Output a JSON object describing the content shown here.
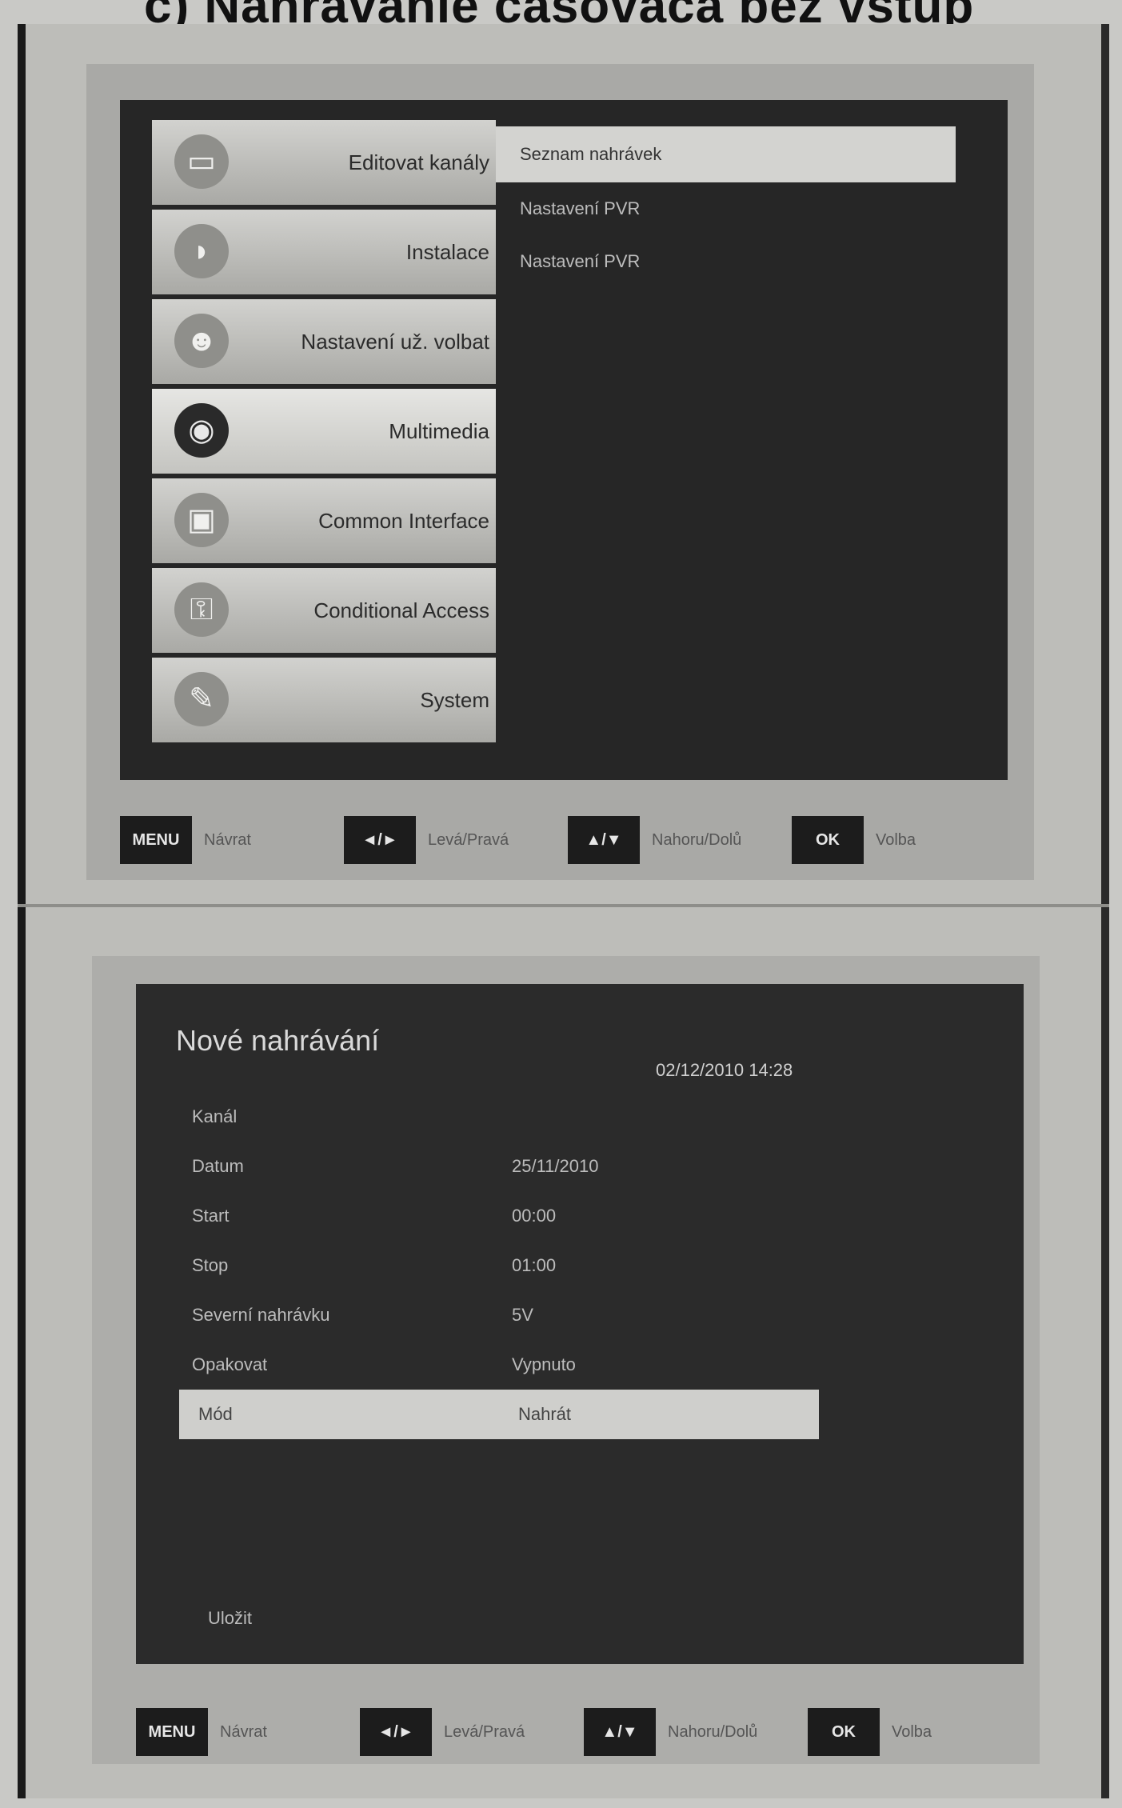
{
  "page": {
    "heading": "c)  Nahrávanie časovača bez vstup"
  },
  "top_screen": {
    "menu": [
      {
        "label": "Editovat kanály",
        "icon": "tv-icon"
      },
      {
        "label": "Instalace",
        "icon": "satellite-dish-icon"
      },
      {
        "label": "Nastavení už. volbat",
        "icon": "user-settings-icon"
      },
      {
        "label": "Multimedia",
        "icon": "multimedia-icon"
      },
      {
        "label": "Common Interface",
        "icon": "ci-card-icon"
      },
      {
        "label": "Conditional Access",
        "icon": "key-icon"
      },
      {
        "label": "System",
        "icon": "tools-icon"
      }
    ],
    "submenu": [
      {
        "label": "Seznam nahrávek"
      },
      {
        "label": "Nastavení PVR"
      },
      {
        "label": "Nastavení PVR"
      }
    ],
    "help": [
      {
        "key": "MENU",
        "label": "Návrat"
      },
      {
        "key": "◄/►",
        "label": "Levá/Pravá"
      },
      {
        "key": "▲/▼",
        "label": "Nahoru/Dolů"
      },
      {
        "key": "OK",
        "label": "Volba"
      }
    ]
  },
  "bottom_screen": {
    "title": "Nové nahrávání",
    "datetime": "02/12/2010 14:28",
    "rows": [
      {
        "label": "Kanál",
        "value": ""
      },
      {
        "label": "Datum",
        "value": "25/11/2010"
      },
      {
        "label": "Start",
        "value": "00:00"
      },
      {
        "label": "Stop",
        "value": "01:00"
      },
      {
        "label": "Severní nahrávku",
        "value": "5V"
      },
      {
        "label": "Opakovat",
        "value": "Vypnuto"
      },
      {
        "label": "Mód",
        "value": "Nahrát"
      }
    ],
    "save": "Uložit",
    "help": [
      {
        "key": "MENU",
        "label": "Návrat"
      },
      {
        "key": "◄/►",
        "label": "Levá/Pravá"
      },
      {
        "key": "▲/▼",
        "label": "Nahoru/Dolů"
      },
      {
        "key": "OK",
        "label": "Volba"
      }
    ]
  }
}
